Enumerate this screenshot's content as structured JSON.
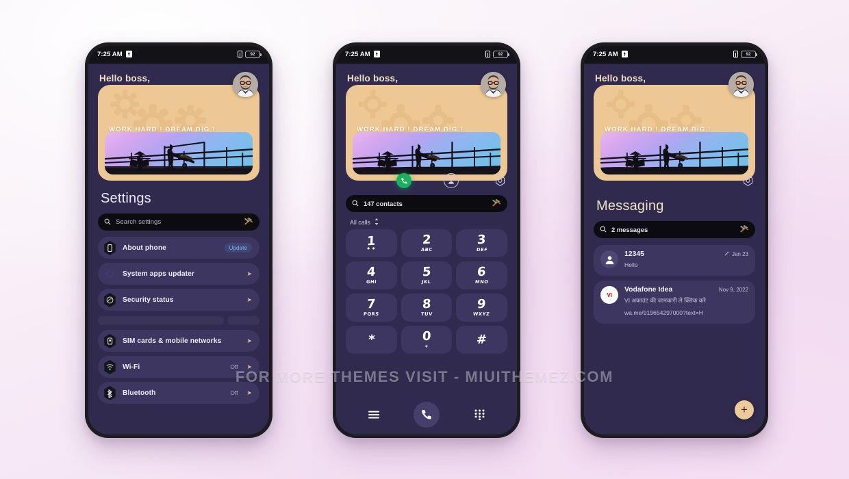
{
  "theme": {
    "page_bg_start": "#fdfbfd",
    "page_bg_end": "#f2dcf1",
    "screen_bg": "#302b4e",
    "card_bg": "#3c3660",
    "widget_bg": "#edc794",
    "accent_gold": "#eedfc5",
    "chevron_gold": "#e3c089",
    "search_bg": "#0c0c10",
    "call_green": "#18b25f",
    "fab_bg": "#eecb96"
  },
  "watermark": "FOR MORE THEMES VISIT - MIUITHEMEZ.COM",
  "status_bar": {
    "time": "7:25 AM",
    "battery_level": "92",
    "icons": [
      "download-badge-icon",
      "sim-icon",
      "battery-icon"
    ]
  },
  "widget": {
    "greeting": "Hello boss,",
    "avatar": "user-avatar",
    "motivation_text": "WORK HARD ! DREAM BIG !",
    "background_icon": "gears-icon",
    "photo_alt": "farmer-silhouette-photo"
  },
  "quick_icons": [
    {
      "name": "call-icon",
      "label": "Phone"
    },
    {
      "name": "contacts-icon",
      "label": "Contacts"
    },
    {
      "name": "gear-icon",
      "label": "Settings"
    }
  ],
  "phone1_settings": {
    "title": "Settings",
    "search": {
      "placeholder": "Search settings",
      "leading_icon": "search-icon",
      "trailing_icon": "hammer-tools-icon"
    },
    "rows": [
      {
        "icon": "phone-info-icon",
        "label": "About phone",
        "badge": "Update",
        "value": "",
        "chevron": false
      },
      {
        "icon": "refresh-icon",
        "label": "System apps updater",
        "badge": "",
        "value": "",
        "chevron": true
      },
      {
        "icon": "shield-icon",
        "label": "Security status",
        "badge": "",
        "value": "",
        "chevron": true
      }
    ],
    "rows2": [
      {
        "icon": "sim-card-icon",
        "label": "SIM cards & mobile networks",
        "value": "",
        "chevron": true
      },
      {
        "icon": "wifi-icon",
        "label": "Wi-Fi",
        "value": "Off",
        "chevron": true
      },
      {
        "icon": "bluetooth-icon",
        "label": "Bluetooth",
        "value": "Off",
        "chevron": true
      }
    ]
  },
  "phone2_dialer": {
    "search": {
      "value": "147 contacts",
      "leading_icon": "search-icon",
      "trailing_icon": "hammer-tools-icon"
    },
    "filter_label": "All calls",
    "filter_icon": "sort-icon",
    "keys": [
      {
        "num": "1",
        "sub": "••"
      },
      {
        "num": "2",
        "sub": "ABC"
      },
      {
        "num": "3",
        "sub": "DEF"
      },
      {
        "num": "4",
        "sub": "GHI"
      },
      {
        "num": "5",
        "sub": "JKL"
      },
      {
        "num": "6",
        "sub": "MNO"
      },
      {
        "num": "7",
        "sub": "PQRS"
      },
      {
        "num": "8",
        "sub": "TUV"
      },
      {
        "num": "9",
        "sub": "WXYZ"
      },
      {
        "num": "*",
        "sub": ""
      },
      {
        "num": "0",
        "sub": "+"
      },
      {
        "num": "#",
        "sub": ""
      }
    ],
    "navbar": [
      {
        "name": "menu-icon",
        "label": "Menu"
      },
      {
        "name": "call-button",
        "label": "Call"
      },
      {
        "name": "keypad-icon",
        "label": "Keypad"
      }
    ]
  },
  "phone3_messaging": {
    "title": "Messaging",
    "search": {
      "value": "2 messages",
      "leading_icon": "search-icon",
      "trailing_icon": "hammer-tools-icon"
    },
    "messages": [
      {
        "avatar": "person-icon",
        "sender": "12345",
        "snippet": "Hello",
        "date": "Jan 23",
        "status_icon": "sent-check-icon"
      },
      {
        "avatar": "vodafone-idea-logo",
        "avatar_text": "VI",
        "sender": "Vodafone Idea",
        "snippet": "VI अकाउंट की जानकारी ले क्लिक करे wa.me/919654297000?text=H",
        "date": "Nov 9, 2022",
        "status_icon": ""
      }
    ],
    "fab": {
      "name": "compose-fab",
      "label": "+"
    }
  }
}
